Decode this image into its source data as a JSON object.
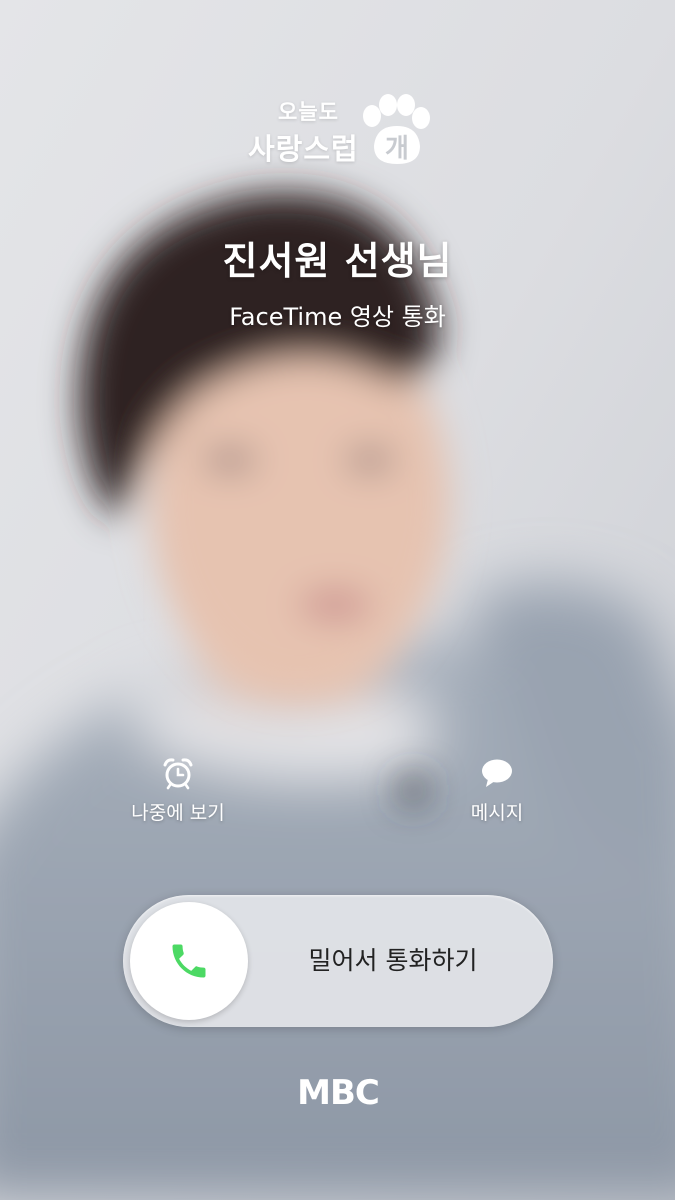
{
  "logo": {
    "line1": "오늘도",
    "line2": "사랑스럽",
    "paw_text": "개",
    "icon": "paw-icon"
  },
  "caller": {
    "name": "진서원 선생님",
    "call_type": "FaceTime 영상 통화"
  },
  "actions": {
    "remind": {
      "label": "나중에 보기",
      "icon": "alarm-clock-icon"
    },
    "message": {
      "label": "메시지",
      "icon": "message-bubble-icon"
    }
  },
  "slider": {
    "label": "밀어서 통화하기",
    "icon": "phone-icon",
    "accent": "#4cd964"
  },
  "footer": {
    "brand": "MBC"
  },
  "colors": {
    "text": "#ffffff",
    "slider_bg": "#e2e4e8",
    "slider_text": "#222222",
    "phone_green": "#4cd964"
  }
}
